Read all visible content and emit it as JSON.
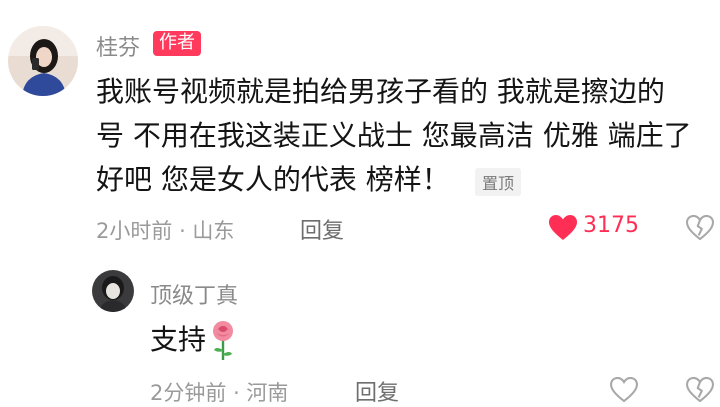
{
  "comment": {
    "author": "桂芬",
    "badge": "作者",
    "lines": [
      "我账号视频就是拍给男孩子看的 我就是擦边的",
      "号 不用在我这装正义战士 您最高洁 优雅 端庄了",
      "好吧 您是女人的代表 榜样！"
    ],
    "pin_label": "置顶",
    "time": "2小时前",
    "location": "山东",
    "reply_label": "回复",
    "like_count": "3175",
    "liked": true
  },
  "reply": {
    "author": "顶级丁真",
    "text": "支持",
    "time": "2分钟前",
    "location": "河南",
    "reply_label": "回复",
    "liked": false
  },
  "colors": {
    "badge_bg": "#ff3a5c",
    "like_red": "#ff2e55",
    "meta_gray": "#9a9a9a"
  },
  "icons": {
    "like": "heart-icon",
    "dislike": "broken-heart-icon",
    "rose": "rose-icon"
  }
}
